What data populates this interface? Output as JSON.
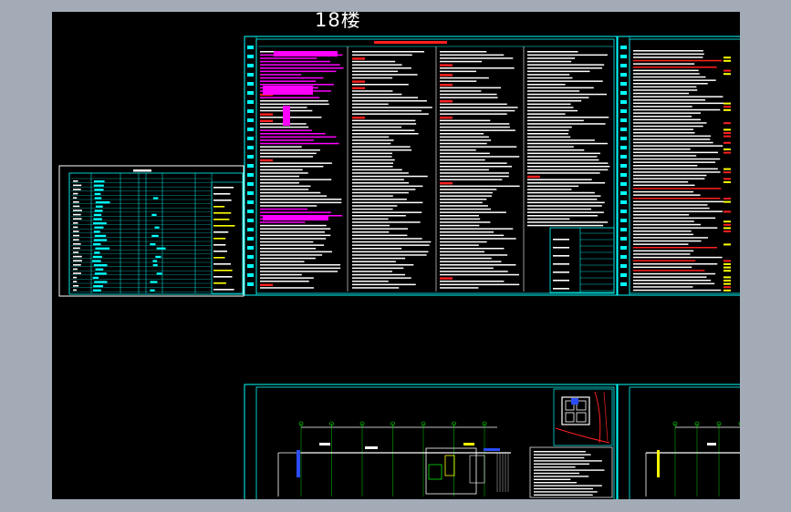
{
  "canvas": {
    "title": "18楼",
    "background": "#000000",
    "chrome_background": "#a3abb7"
  },
  "drawing": {
    "sheets": [
      {
        "name": "cover-sheet-left",
        "kind": "table"
      },
      {
        "name": "specification-sheet-main",
        "kind": "text-notes"
      },
      {
        "name": "specification-sheet-right",
        "kind": "text-notes"
      },
      {
        "name": "floor-plan-sheet",
        "kind": "plan"
      },
      {
        "name": "floor-plan-sheet-right",
        "kind": "plan"
      }
    ],
    "line_colors": {
      "frame": "#00ffff",
      "text": "#ffffff",
      "highlight": "#ff00ff",
      "accent_red": "#ff2020",
      "accent_yellow": "#ffff00",
      "accent_green": "#00ff00",
      "accent_blue": "#2a4cff"
    }
  }
}
